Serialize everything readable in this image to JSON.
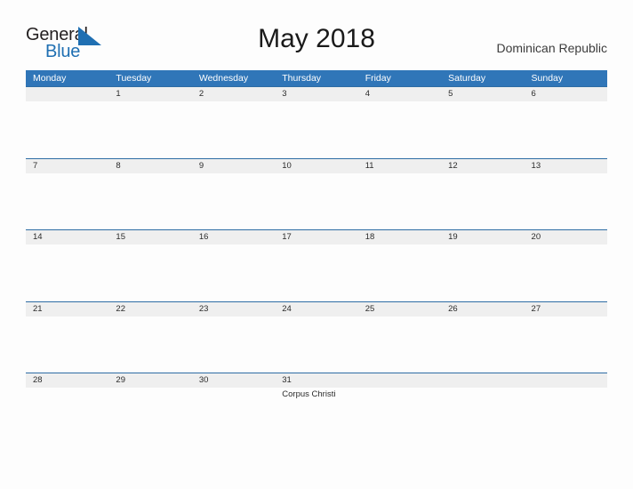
{
  "brand": {
    "name_part1": "General",
    "name_part2": "Blue",
    "color_dark": "#231f20",
    "color_blue": "#1f6fb2"
  },
  "header": {
    "title": "May 2018",
    "country": "Dominican Republic"
  },
  "theme": {
    "header_blue": "#3076b8",
    "band_gray": "#efefef",
    "band_rule": "#2e6da4",
    "page_bg": "#fdfdfd"
  },
  "calendar": {
    "weekdays": [
      "Monday",
      "Tuesday",
      "Wednesday",
      "Thursday",
      "Friday",
      "Saturday",
      "Sunday"
    ],
    "weeks": [
      {
        "days": [
          {
            "num": "",
            "events": []
          },
          {
            "num": "1",
            "events": []
          },
          {
            "num": "2",
            "events": []
          },
          {
            "num": "3",
            "events": []
          },
          {
            "num": "4",
            "events": []
          },
          {
            "num": "5",
            "events": []
          },
          {
            "num": "6",
            "events": []
          }
        ]
      },
      {
        "days": [
          {
            "num": "7",
            "events": []
          },
          {
            "num": "8",
            "events": []
          },
          {
            "num": "9",
            "events": []
          },
          {
            "num": "10",
            "events": []
          },
          {
            "num": "11",
            "events": []
          },
          {
            "num": "12",
            "events": []
          },
          {
            "num": "13",
            "events": []
          }
        ]
      },
      {
        "days": [
          {
            "num": "14",
            "events": []
          },
          {
            "num": "15",
            "events": []
          },
          {
            "num": "16",
            "events": []
          },
          {
            "num": "17",
            "events": []
          },
          {
            "num": "18",
            "events": []
          },
          {
            "num": "19",
            "events": []
          },
          {
            "num": "20",
            "events": []
          }
        ]
      },
      {
        "days": [
          {
            "num": "21",
            "events": []
          },
          {
            "num": "22",
            "events": []
          },
          {
            "num": "23",
            "events": []
          },
          {
            "num": "24",
            "events": []
          },
          {
            "num": "25",
            "events": []
          },
          {
            "num": "26",
            "events": []
          },
          {
            "num": "27",
            "events": []
          }
        ]
      },
      {
        "days": [
          {
            "num": "28",
            "events": []
          },
          {
            "num": "29",
            "events": []
          },
          {
            "num": "30",
            "events": []
          },
          {
            "num": "31",
            "events": [
              "Corpus Christi"
            ]
          },
          {
            "num": "",
            "events": []
          },
          {
            "num": "",
            "events": []
          },
          {
            "num": "",
            "events": []
          }
        ]
      }
    ]
  }
}
